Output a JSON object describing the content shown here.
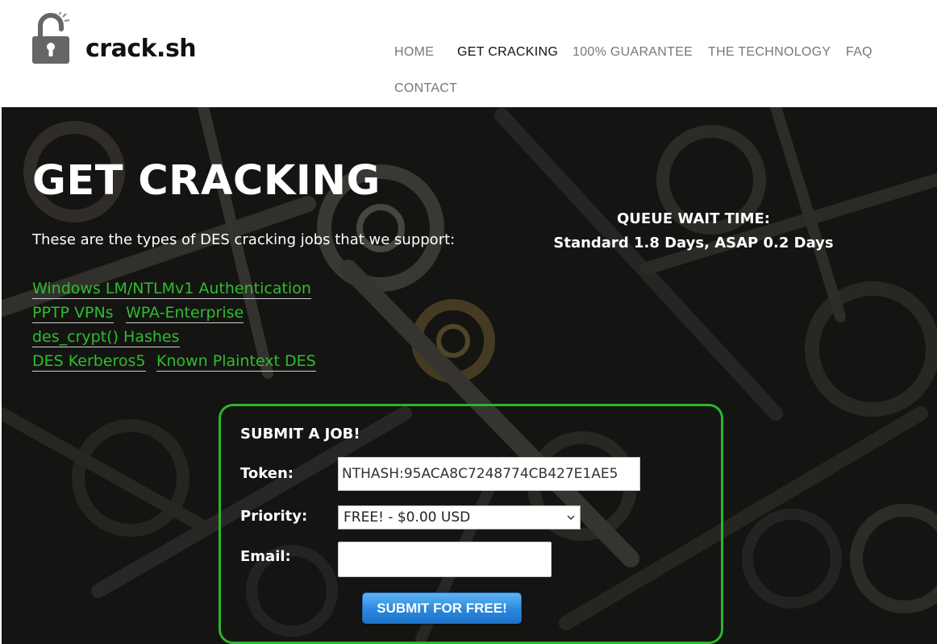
{
  "brand": {
    "name": "crack.sh"
  },
  "nav": {
    "items": [
      {
        "label": "HOME",
        "active": false
      },
      {
        "label": "GET CRACKING",
        "active": true
      },
      {
        "label": "100% GUARANTEE",
        "active": false
      },
      {
        "label": "THE TECHNOLOGY",
        "active": false
      },
      {
        "label": "FAQ",
        "active": false
      },
      {
        "label": "CONTACT",
        "active": false
      }
    ]
  },
  "hero": {
    "title": "GET CRACKING",
    "intro": "These are the types of DES cracking jobs that we support:",
    "queue": {
      "heading": "QUEUE WAIT TIME:",
      "value": "Standard 1.8 Days, ASAP 0.2 Days"
    },
    "job_types": [
      "Windows LM/NTLMv1 Authentication",
      "PPTP VPNs",
      "WPA-Enterprise",
      "des_crypt() Hashes",
      "DES Kerberos5",
      "Known Plaintext DES"
    ]
  },
  "form": {
    "heading": "SUBMIT A JOB!",
    "token_label": "Token:",
    "token_value": "NTHASH:95ACA8C7248774CB427E1AE5",
    "priority_label": "Priority:",
    "priority_selected": "FREE! - $0.00 USD",
    "email_label": "Email:",
    "email_value": "",
    "submit_label": "SUBMIT FOR FREE!"
  },
  "colors": {
    "link_green": "#2ebd2e",
    "form_border": "#2ab52a",
    "button_blue": "#2a88de",
    "nav_active": "#111111",
    "nav_inactive": "#777777"
  },
  "icons": {
    "logo": "padlock-icon",
    "select_arrow": "chevron-down-icon"
  }
}
